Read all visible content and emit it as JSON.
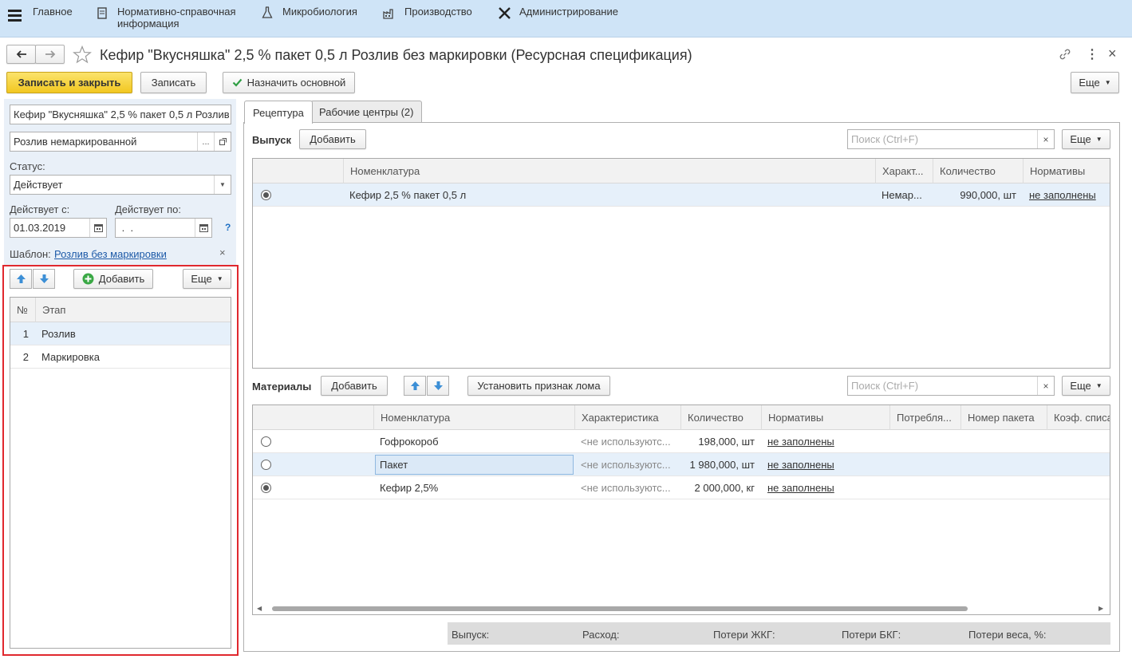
{
  "topbar": {
    "menu_icon": "hamburger-icon",
    "items": [
      {
        "label": "Главное",
        "icon": "none"
      },
      {
        "label": "Нормативно-справочная информация",
        "icon": "document-icon"
      },
      {
        "label": "Микробиология",
        "icon": "flask-icon"
      },
      {
        "label": "Производство",
        "icon": "factory-icon"
      },
      {
        "label": "Администрирование",
        "icon": "tools-icon"
      }
    ]
  },
  "window": {
    "title": "Кефир \"Вкусняшка\" 2,5 % пакет 0,5 л Розлив без маркировки (Ресурсная спецификация)",
    "more_glyph": "⋮",
    "close_glyph": "×"
  },
  "toolbar": {
    "save_close": "Записать и закрыть",
    "save": "Записать",
    "set_main": "Назначить основной",
    "more": "Еще"
  },
  "left": {
    "name_value": "Кефир \"Вкусняшка\" 2,5 % пакет 0,5 л Розлив без маркировки",
    "process_value": "Розлив немаркированной",
    "status_label": "Статус:",
    "status_value": "Действует",
    "from_label": "Действует с:",
    "from_value": "01.03.2019",
    "to_label": "Действует по:",
    "to_value": " .  .",
    "help_glyph": "?",
    "template_label": "Шаблон:",
    "template_value": "Розлив без маркировки",
    "stages": {
      "add_label": "Добавить",
      "more_label": "Еще",
      "col_num": "№",
      "col_stage": "Этап",
      "rows": [
        {
          "num": "1",
          "name": "Розлив"
        },
        {
          "num": "2",
          "name": "Маркировка"
        }
      ]
    }
  },
  "tabs": [
    {
      "label": "Рецептура",
      "active": true
    },
    {
      "label": "Рабочие центры (2)",
      "active": false
    }
  ],
  "output": {
    "title": "Выпуск",
    "add_label": "Добавить",
    "search_placeholder": "Поиск (Ctrl+F)",
    "more_label": "Еще",
    "columns": [
      "Номенклатура",
      "Характ...",
      "Количество",
      "Нормативы"
    ],
    "rows": [
      {
        "item": "Кефир 2,5 % пакет 0,5 л",
        "char": "Немар...",
        "qty": "990,000, шт",
        "norms": "не заполнены",
        "main": true
      }
    ]
  },
  "materials": {
    "title": "Материалы",
    "add_label": "Добавить",
    "scrap_label": "Установить признак лома",
    "search_placeholder": "Поиск (Ctrl+F)",
    "more_label": "Еще",
    "columns": [
      "Номенклатура",
      "Характеристика",
      "Количество",
      "Нормативы",
      "Потребля...",
      "Номер пакета",
      "Коэф. списа"
    ],
    "rows": [
      {
        "item": "Гофрокороб",
        "char": "<не используютс...",
        "qty": "198,000, шт",
        "norms": "не заполнены",
        "main": false
      },
      {
        "item": "Пакет",
        "char": "<не используютс...",
        "qty": "1 980,000, шт",
        "norms": "не заполнены",
        "main": false
      },
      {
        "item": "Кефир 2,5%",
        "char": "<не используютс...",
        "qty": "2 000,000, кг",
        "norms": "не заполнены",
        "main": true
      }
    ]
  },
  "footer": {
    "output": "Выпуск:",
    "consumption": "Расход:",
    "loss_zhkg": "Потери ЖКГ:",
    "loss_bkg": "Потери БКГ:",
    "loss_weight": "Потери веса, %:"
  },
  "colors": {
    "highlight_frame": "#e0282e",
    "accent_yellow": "#f2c720",
    "topbar": "#cfe4f7"
  }
}
